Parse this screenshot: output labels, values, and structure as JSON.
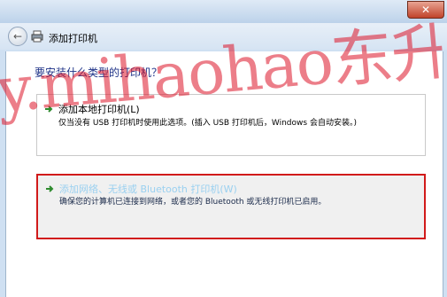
{
  "window": {
    "title": "添加打印机",
    "close_label": "✕"
  },
  "nav": {
    "back_icon": "back-arrow-icon"
  },
  "main": {
    "heading": "要安装什么类型的打印机？"
  },
  "options": [
    {
      "title": "添加本地打印机(L)",
      "description": "仅当没有 USB 打印机时使用此选项。(插入 USB 打印机后，Windows 会自动安装。)",
      "icon": "green-arrow-icon"
    },
    {
      "title": "添加网络、无线或 Bluetooth 打印机(W)",
      "description": "确保您的计算机已连接到网络，或者您的 Bluetooth 或无线打印机已启用。",
      "icon": "green-arrow-icon"
    }
  ],
  "watermark": {
    "text": "y.mihaohao东升百科网"
  },
  "colors": {
    "heading": "#1e3287",
    "highlight_border": "#d11a1a",
    "arrow": "#2e8b2e",
    "watermark": "#dc1428"
  }
}
